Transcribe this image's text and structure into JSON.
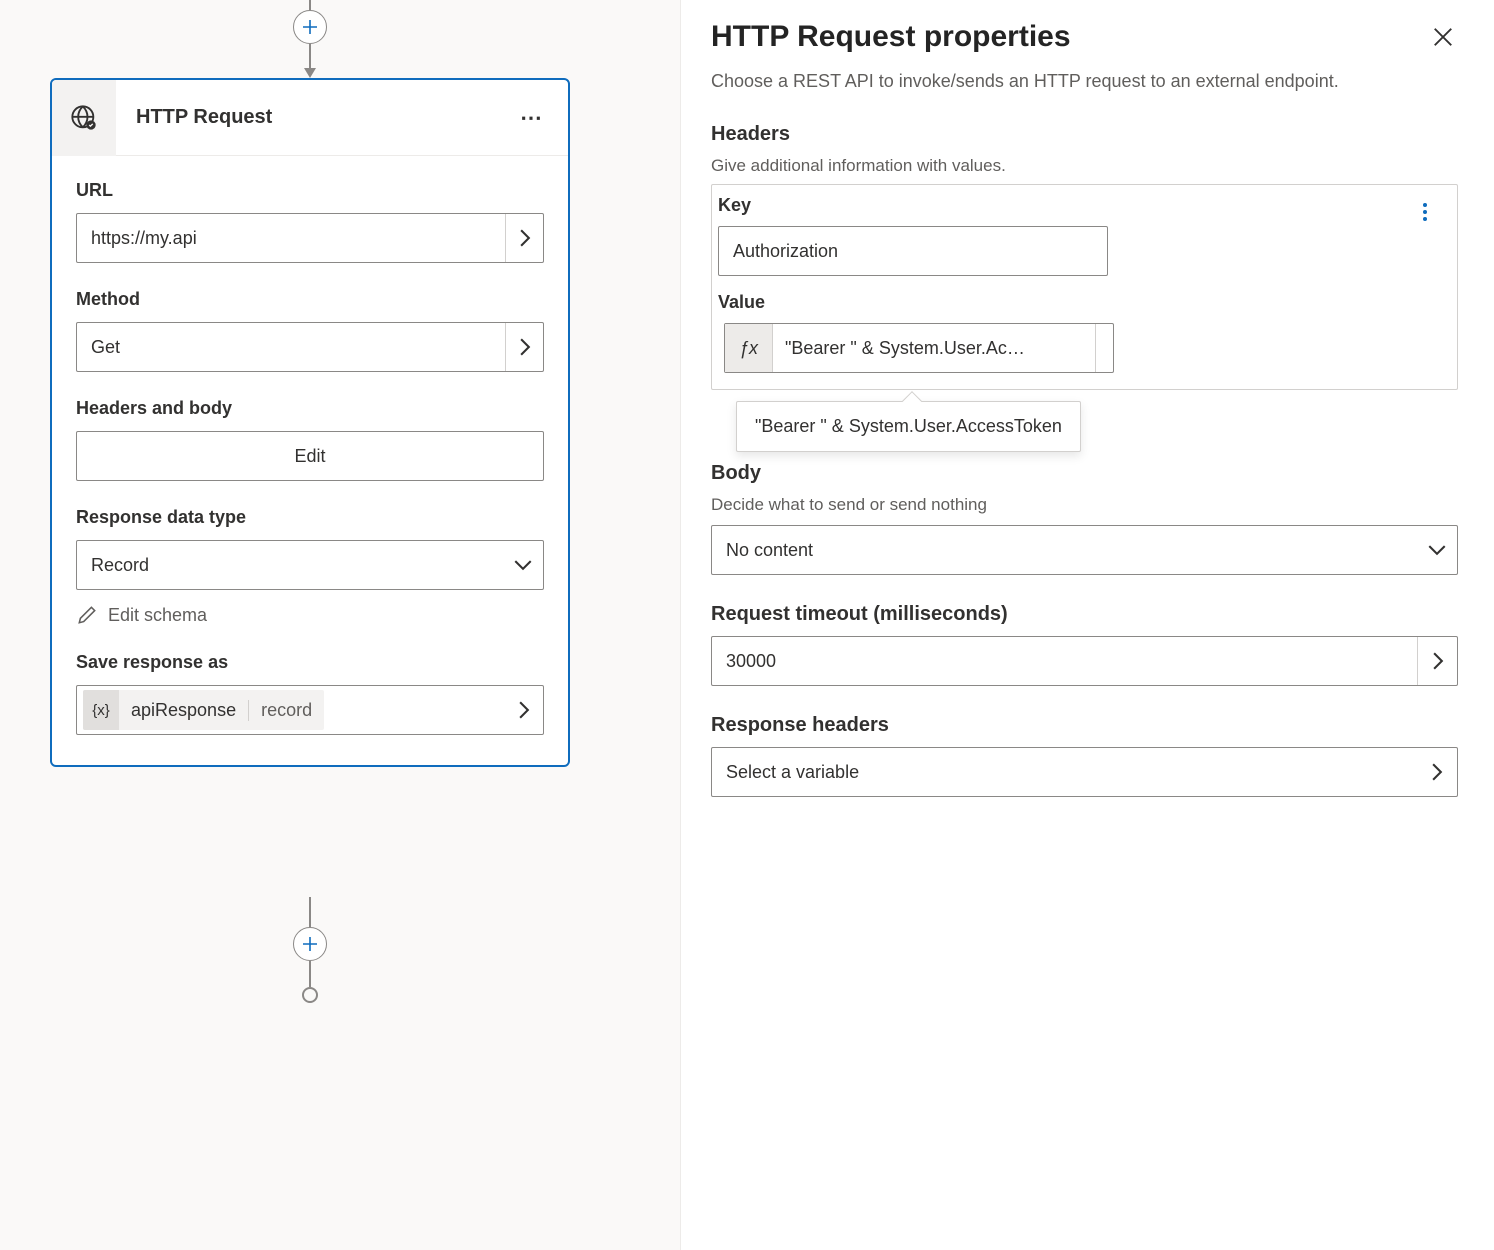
{
  "node": {
    "title": "HTTP Request",
    "url": {
      "label": "URL",
      "value": "https://my.api"
    },
    "method": {
      "label": "Method",
      "value": "Get"
    },
    "headers_body": {
      "label": "Headers and body",
      "edit_label": "Edit"
    },
    "response_type": {
      "label": "Response data type",
      "value": "Record"
    },
    "edit_schema_label": "Edit schema",
    "save_as": {
      "label": "Save response as",
      "var_name": "apiResponse",
      "var_type": "record"
    }
  },
  "panel": {
    "title": "HTTP Request properties",
    "description": "Choose a REST API to invoke/sends an HTTP request to an external endpoint.",
    "headers": {
      "title": "Headers",
      "hint": "Give additional information with values.",
      "key_label": "Key",
      "key_value": "Authorization",
      "value_label": "Value",
      "value_display": "\"Bearer \" & System.User.Ac…",
      "value_full": "\"Bearer \" & System.User.AccessToken"
    },
    "body": {
      "title": "Body",
      "hint": "Decide what to send or send nothing",
      "value": "No content"
    },
    "timeout": {
      "title": "Request timeout (milliseconds)",
      "value": "30000"
    },
    "response_headers": {
      "title": "Response headers",
      "placeholder": "Select a variable"
    }
  }
}
